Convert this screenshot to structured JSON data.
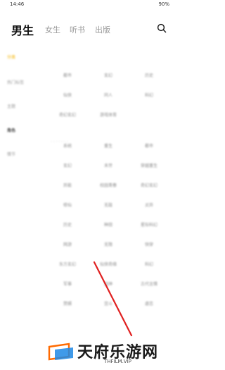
{
  "status_bar": {
    "time": "14:46",
    "battery": "90%"
  },
  "tabs": [
    {
      "label": "男生",
      "active": true
    },
    {
      "label": "女生",
      "active": false
    },
    {
      "label": "听书",
      "active": false
    },
    {
      "label": "出版",
      "active": false
    }
  ],
  "sidebar": {
    "items": [
      {
        "label": "分类",
        "state": "active"
      },
      {
        "label": "热门标签",
        "state": "normal"
      },
      {
        "label": "主题",
        "state": "normal"
      },
      {
        "label": "角色",
        "state": "bold"
      },
      {
        "label": "情节",
        "state": "normal"
      }
    ]
  },
  "grid": {
    "rows": [
      [
        "都市",
        "玄幻",
        "历史"
      ],
      [
        "仙侠",
        "同人",
        "科幻"
      ],
      [
        "奇幻玄幻",
        "游戏体育",
        ""
      ],
      [
        "系统",
        "重生",
        "都市"
      ],
      [
        "玄幻",
        "末世",
        "穿越重生"
      ],
      [
        "异能",
        "校园青春",
        "奇幻玄幻"
      ],
      [
        "修仙",
        "无敌",
        "灵异"
      ],
      [
        "历史",
        "种田",
        "星际科幻"
      ],
      [
        "网游",
        "无限",
        "快穿"
      ],
      [
        "东方玄幻",
        "仙侠奇缘",
        "科幻"
      ],
      [
        "军事",
        "战神",
        "古代言情"
      ],
      [
        "赘婿",
        "宫斗",
        "虐恋"
      ]
    ]
  },
  "watermark": {
    "title": "天府乐游网",
    "subtitle": "THFILM.VIP",
    "line_color": "#e02020"
  }
}
